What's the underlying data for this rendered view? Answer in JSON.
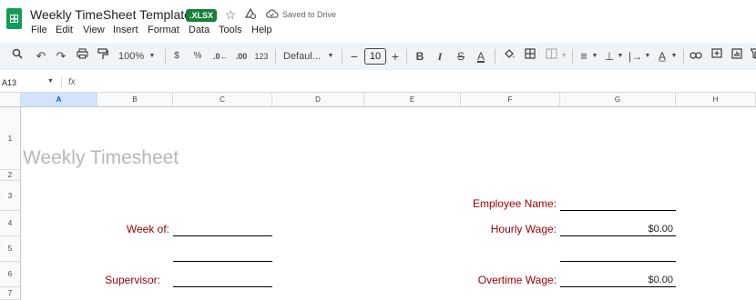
{
  "app": {
    "doc_title": "Weekly TimeSheet Template",
    "format_badge": ".XLSX",
    "save_status": "Saved to Drive"
  },
  "menu": [
    "File",
    "Edit",
    "View",
    "Insert",
    "Format",
    "Data",
    "Tools",
    "Help"
  ],
  "toolbar": {
    "zoom": "100%",
    "currency": "$",
    "percent": "%",
    "dec_decrease": ".0←",
    "dec_increase": ".00",
    "number_format": "123",
    "font": "Defaul...",
    "font_size": "10"
  },
  "formula_bar": {
    "name_box": "A13",
    "fx": "fx"
  },
  "columns": [
    "A",
    "B",
    "C",
    "D",
    "E",
    "F",
    "G",
    "H"
  ],
  "rows": [
    "1",
    "2",
    "3",
    "4",
    "5",
    "6",
    "7"
  ],
  "sheet": {
    "title": "Weekly Timesheet",
    "week_of_label": "Week of:",
    "supervisor_label": "Supervisor:",
    "employee_name_label": "Employee Name:",
    "hourly_wage_label": "Hourly Wage:",
    "hourly_wage_value": "$0.00",
    "overtime_wage_label": "Overtime Wage:",
    "overtime_wage_value": "$0.00"
  },
  "colors": {
    "label": "#990000",
    "title": "#b7b7b7",
    "sheets_green": "#0f9d58",
    "selected_header": "#d3e3fd"
  }
}
